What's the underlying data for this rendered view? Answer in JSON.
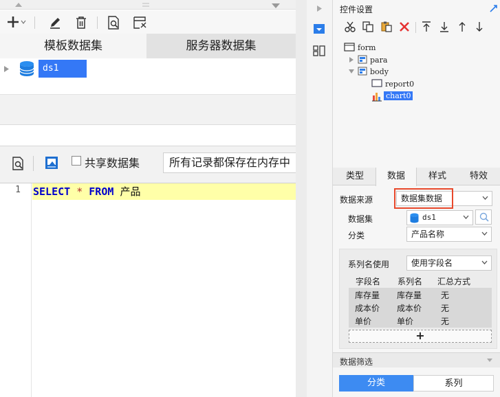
{
  "left": {
    "tabs": [
      "模板数据集",
      "服务器数据集"
    ],
    "dataset_node": "ds1",
    "share_label": "共享数据集",
    "memory_option": "所有记录都保存在内存中",
    "editor": {
      "line_number": "1",
      "sql_keyword_select": "SELECT",
      "sql_star": "*",
      "sql_keyword_from": "FROM",
      "sql_table": "产品"
    }
  },
  "panel": {
    "title": "控件设置",
    "tree": {
      "form": "form",
      "para": "para",
      "body": "body",
      "report": "report0",
      "chart": "chart0"
    },
    "tabs": [
      "类型",
      "数据",
      "样式",
      "特效"
    ],
    "active_tab": "数据",
    "source_label": "数据来源",
    "source_value": "数据集数据",
    "dataset_label": "数据集",
    "dataset_value": "ds1",
    "category_label": "分类",
    "category_value": "产品名称",
    "series_label": "系列名使用",
    "series_value": "使用字段名",
    "table": {
      "headers": [
        "字段名",
        "系列名",
        "汇总方式"
      ],
      "rows": [
        [
          "库存量",
          "库存量",
          "无"
        ],
        [
          "成本价",
          "成本价",
          "无"
        ],
        [
          "单价",
          "单价",
          "无"
        ]
      ]
    },
    "add_label": "+",
    "filter_label": "数据筛选",
    "filter_tabs": [
      "分类",
      "系列"
    ]
  },
  "colors": {
    "selection": "#3478f6",
    "highlight_border": "#e8482b",
    "sql_keyword": "#0000cc",
    "active_line": "#ffffa8"
  }
}
